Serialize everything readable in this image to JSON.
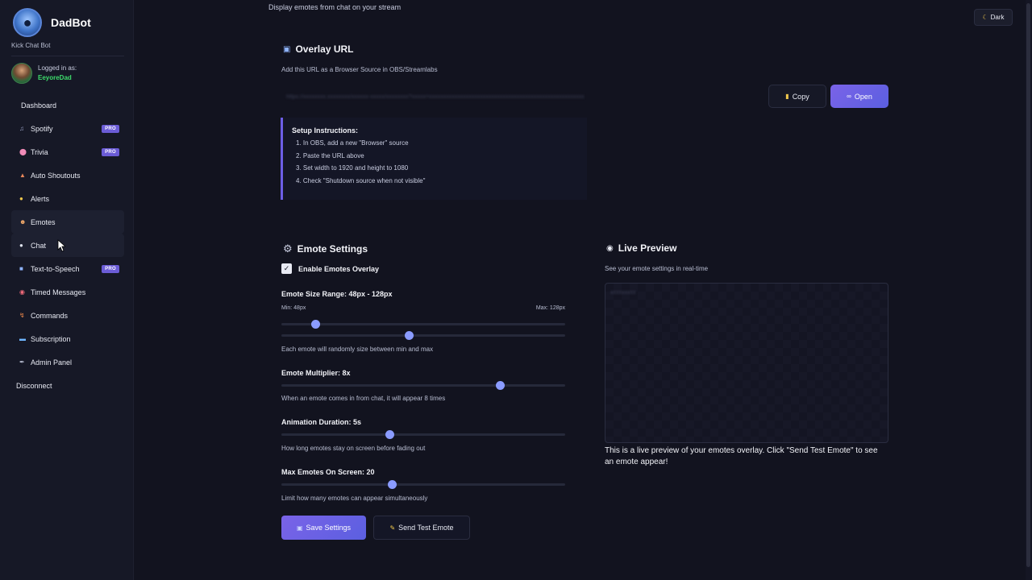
{
  "sidebar": {
    "brand_name": "DadBot",
    "brand_sub": "Kick Chat Bot",
    "logged_in_label": "Logged in as:",
    "username": "EeyoreDad",
    "items": [
      {
        "label": "Dashboard",
        "icon": "none"
      },
      {
        "label": "Spotify",
        "icon": "music-icon",
        "badge": "PRO"
      },
      {
        "label": "Trivia",
        "icon": "brain-icon",
        "badge": "PRO"
      },
      {
        "label": "Auto Shoutouts",
        "icon": "megaphone-icon"
      },
      {
        "label": "Alerts",
        "icon": "bell-icon"
      },
      {
        "label": "Emotes",
        "icon": "smiley-icon"
      },
      {
        "label": "Chat",
        "icon": "speech-bubble-icon"
      },
      {
        "label": "Text-to-Speech",
        "icon": "speaker-icon",
        "badge": "PRO"
      },
      {
        "label": "Timed Messages",
        "icon": "alarm-clock-icon"
      },
      {
        "label": "Commands",
        "icon": "lightning-icon"
      },
      {
        "label": "Subscription",
        "icon": "card-icon"
      },
      {
        "label": "Admin Panel",
        "icon": "wrench-icon"
      },
      {
        "label": "Disconnect",
        "icon": "none"
      }
    ]
  },
  "header": {
    "subtitle": "Display emotes from chat on your stream",
    "theme_label": "Dark"
  },
  "overlay": {
    "title": "Overlay URL",
    "description": "Add this URL as a Browser Source in OBS/Streamlabs",
    "copy_label": "Copy",
    "open_label": "Open",
    "instructions_title": "Setup Instructions:",
    "instructions": [
      "1. In OBS, add a new \"Browser\" source",
      "2. Paste the URL above",
      "3. Set width to 1920 and height to 1080",
      "4. Check \"Shutdown source when not visible\""
    ]
  },
  "settings": {
    "title": "Emote Settings",
    "enable_label": "Enable Emotes Overlay",
    "enable_checked": true,
    "size_label": "Emote Size Range: 48px - 128px",
    "size_min_label": "Min: 48px",
    "size_max_label": "Max: 128px",
    "size_min_fraction": 0.12,
    "size_max_fraction": 0.45,
    "size_help": "Each emote will randomly size between min and max",
    "multiplier_label": "Emote Multiplier: 8x",
    "multiplier_fraction": 0.77,
    "multiplier_help": "When an emote comes in from chat, it will appear 8 times",
    "duration_label": "Animation Duration: 5s",
    "duration_fraction": 0.38,
    "duration_help": "How long emotes stay on screen before fading out",
    "max_label": "Max Emotes On Screen: 20",
    "max_fraction": 0.39,
    "max_help": "Limit how many emotes can appear simultaneously",
    "save_label": "Save Settings",
    "test_label": "Send Test Emote"
  },
  "preview": {
    "title": "Live Preview",
    "subtitle": "See your emote settings in real-time",
    "note": "This is a live preview of your emotes overlay. Click \"Send Test Emote\" to see an emote appear!"
  },
  "colors": {
    "accent": "#6d5ee6",
    "username": "#3ddc6b",
    "slider_thumb": "#8a9bff"
  }
}
